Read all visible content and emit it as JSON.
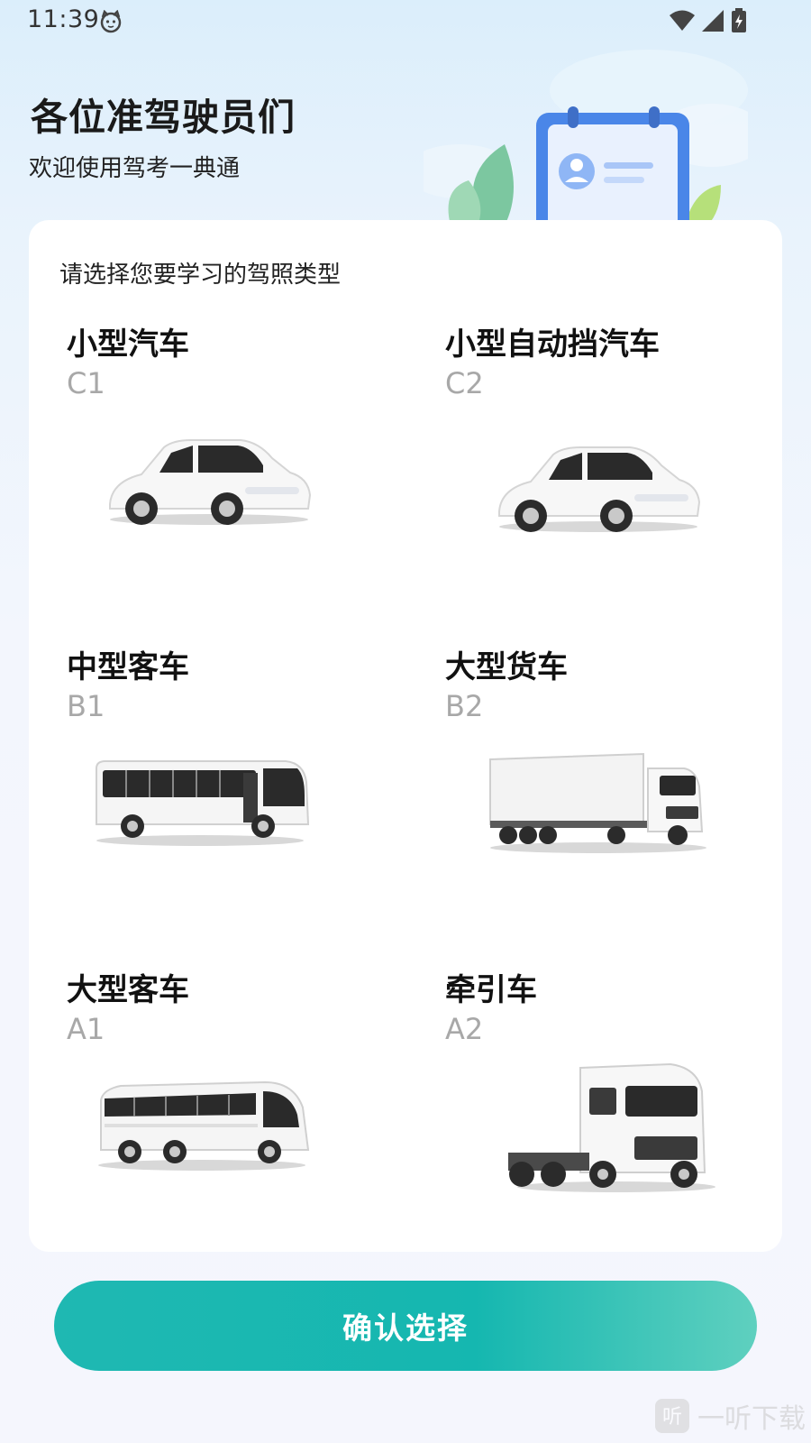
{
  "status_bar": {
    "time": "11:39",
    "icons": [
      "cat-face-icon",
      "wifi-icon",
      "cell-signal-icon",
      "battery-charging-icon"
    ]
  },
  "header": {
    "title": "各位准驾驶员们",
    "subtitle": "欢迎使用驾考一典通"
  },
  "card": {
    "prompt": "请选择您要学习的驾照类型",
    "licenses": [
      {
        "name": "小型汽车",
        "code": "C1",
        "vehicle": "car"
      },
      {
        "name": "小型自动挡汽车",
        "code": "C2",
        "vehicle": "car"
      },
      {
        "name": "中型客车",
        "code": "B1",
        "vehicle": "bus"
      },
      {
        "name": "大型货车",
        "code": "B2",
        "vehicle": "truck"
      },
      {
        "name": "大型客车",
        "code": "A1",
        "vehicle": "coach"
      },
      {
        "name": "牵引车",
        "code": "A2",
        "vehicle": "tractor"
      }
    ]
  },
  "confirm_button": {
    "label": "确认选择",
    "color": "#15b7b0"
  },
  "watermark": {
    "text": "一听下载"
  }
}
